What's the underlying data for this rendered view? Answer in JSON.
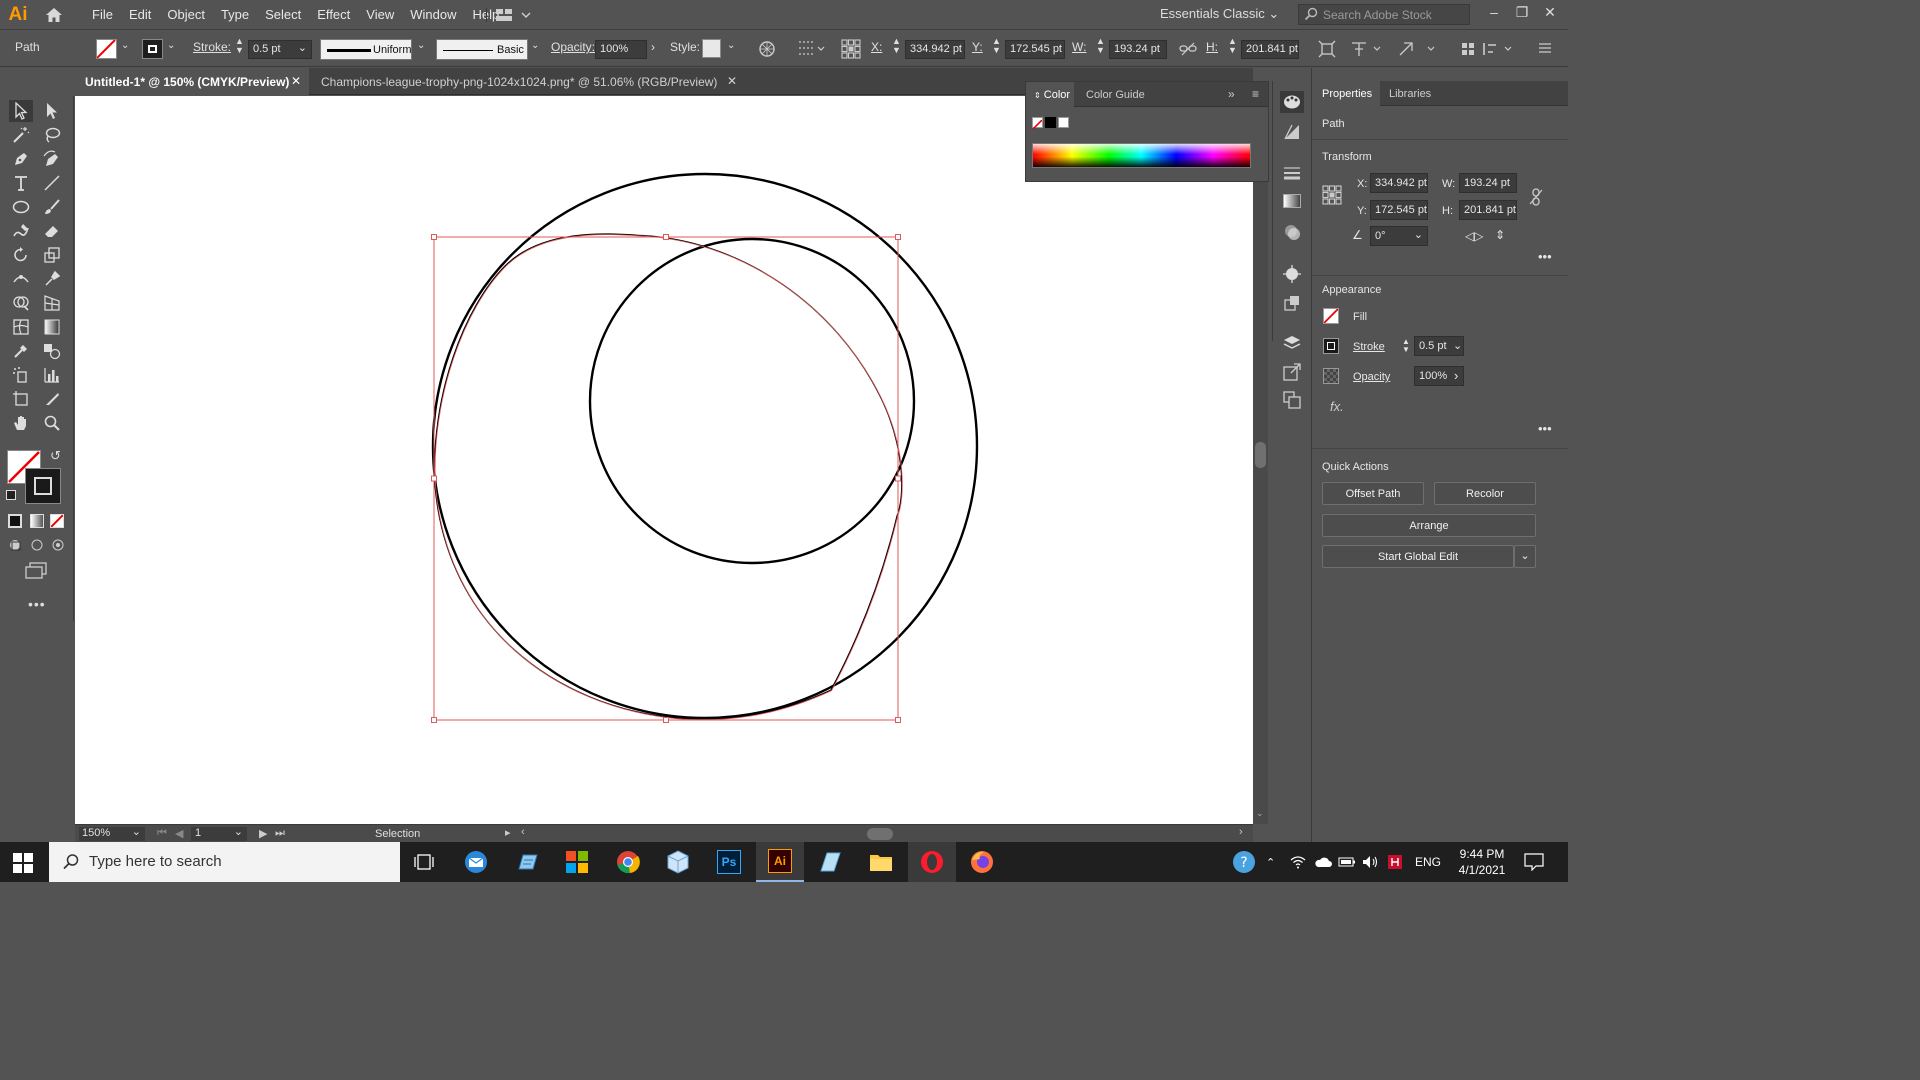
{
  "app": {
    "logo": "Ai"
  },
  "menubar": {
    "items": [
      "File",
      "Edit",
      "Object",
      "Type",
      "Select",
      "Effect",
      "View",
      "Window",
      "Help"
    ],
    "workspace": "Essentials Classic",
    "search_placeholder": "Search Adobe Stock"
  },
  "control": {
    "object_type": "Path",
    "stroke_label": "Stroke:",
    "stroke_value": "0.5 pt",
    "profile": "Uniform",
    "brush": "Basic",
    "opacity_label": "Opacity:",
    "opacity_value": "100%",
    "style_label": "Style:",
    "x_label": "X:",
    "x_value": "334.942 pt",
    "y_label": "Y:",
    "y_value": "172.545 pt",
    "w_label": "W:",
    "w_value": "193.24 pt",
    "h_label": "H:",
    "h_value": "201.841 pt"
  },
  "tabs": [
    {
      "label": "Untitled-1* @ 150% (CMYK/Preview)",
      "active": true
    },
    {
      "label": "Champions-league-trophy-png-1024x1024.png* @ 51.06% (RGB/Preview)",
      "active": false
    }
  ],
  "color_panel": {
    "tab1": "Color",
    "tab2": "Color Guide"
  },
  "properties": {
    "tab1": "Properties",
    "tab2": "Libraries",
    "object_type": "Path",
    "transform_title": "Transform",
    "x_label": "X:",
    "x_value": "334.942 pt",
    "y_label": "Y:",
    "y_value": "172.545 pt",
    "w_label": "W:",
    "w_value": "193.24 pt",
    "h_label": "H:",
    "h_value": "201.841 pt",
    "angle_value": "0°",
    "appearance_title": "Appearance",
    "fill_label": "Fill",
    "stroke_label": "Stroke",
    "stroke_value": "0.5 pt",
    "opacity_label": "Opacity",
    "opacity_value": "100%",
    "fx_label": "fx.",
    "quick_actions_title": "Quick Actions",
    "offset_path": "Offset Path",
    "recolor": "Recolor",
    "arrange": "Arrange",
    "global_edit": "Start Global Edit"
  },
  "status": {
    "zoom": "150%",
    "artboard": "1",
    "tool": "Selection"
  },
  "taskbar": {
    "search_placeholder": "Type here to search",
    "language": "ENG",
    "time": "9:44 PM",
    "date": "4/1/2021"
  },
  "colors": {
    "selection": "#e05a5a",
    "accent_ai": "#ff9a00"
  }
}
